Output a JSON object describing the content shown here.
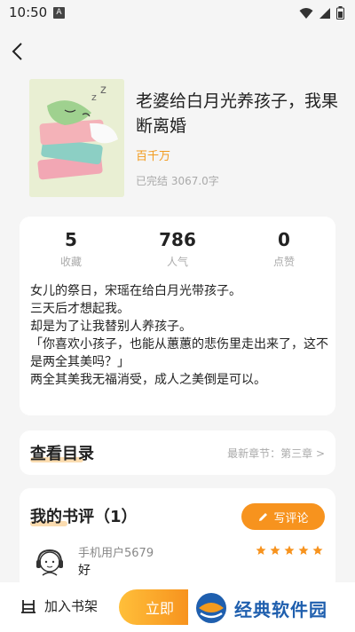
{
  "status_bar": {
    "time": "10:50",
    "notification_letter": "A"
  },
  "book": {
    "title": "老婆给白月光养孩子，我果断离婚",
    "author": "百千万",
    "status": "已完结 3067.0字"
  },
  "stats": [
    {
      "value": "5",
      "label": "收藏"
    },
    {
      "value": "786",
      "label": "人气"
    },
    {
      "value": "0",
      "label": "点赞"
    }
  ],
  "intro": "女儿的祭日，宋瑶在给白月光带孩子。\n三天后才想起我。\n却是为了让我替别人养孩子。\n「你喜欢小孩子，也能从蕙蕙的悲伤里走出来了，这不是两全其美吗？」\n两全其美我无福消受，成人之美倒是可以。",
  "toc": {
    "title": "查看目录",
    "latest": "最新章节：第三章 >"
  },
  "reviews": {
    "title": "我的书评（1）",
    "write_label": "写评论",
    "items": [
      {
        "user": "手机用户5679",
        "text": "好",
        "rating": 5
      }
    ]
  },
  "bottom": {
    "shelf_label": "加入书架",
    "read_label": "立即"
  },
  "watermark": {
    "text": "经典软件园"
  },
  "colors": {
    "accent": "#f7931e",
    "author": "#f29a1c",
    "highlight": "#fbdcb0"
  }
}
